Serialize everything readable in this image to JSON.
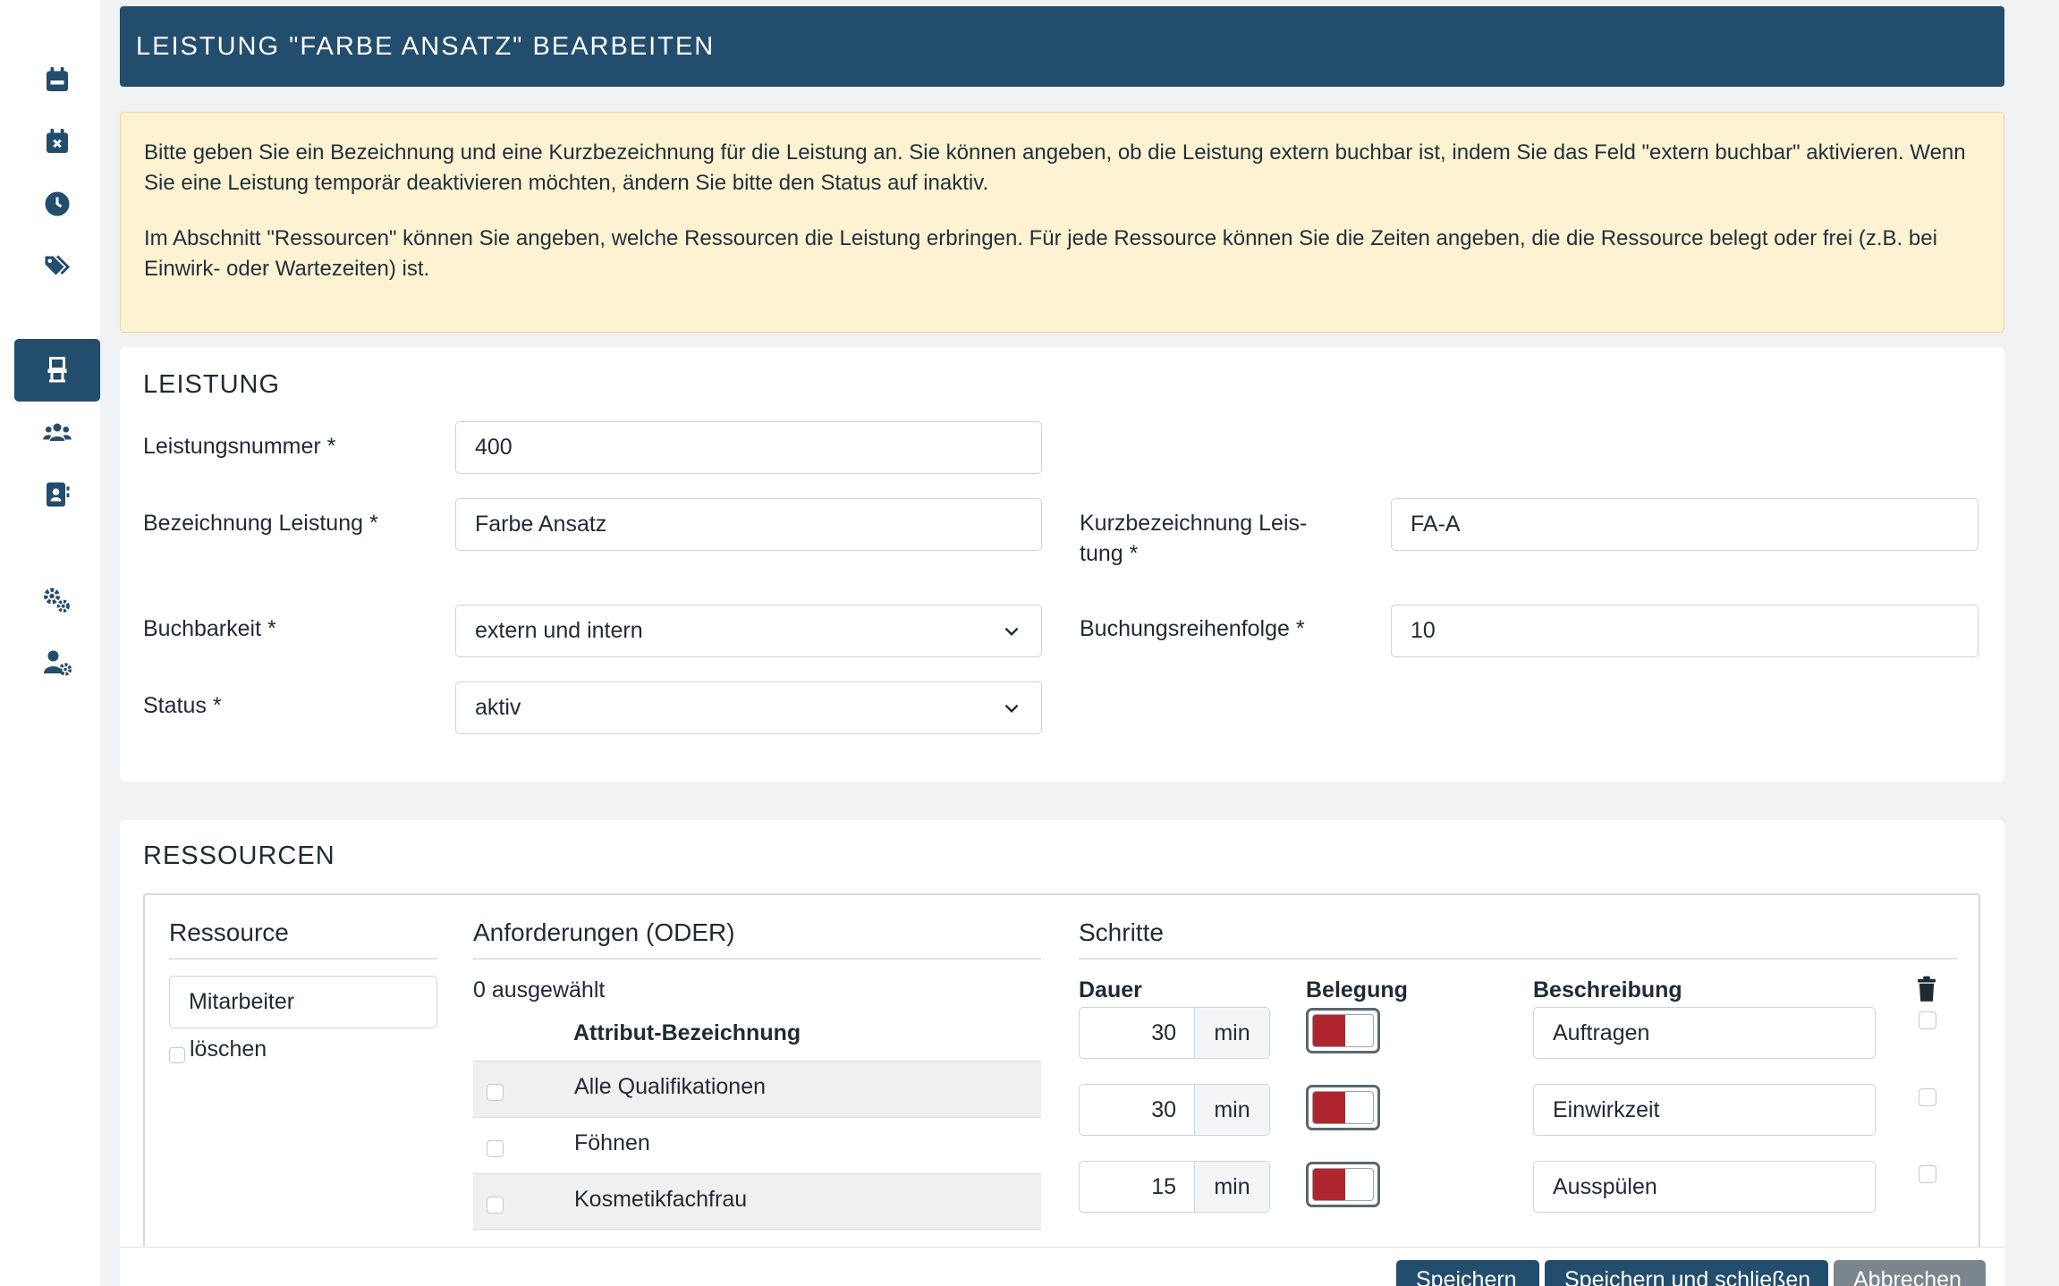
{
  "header": {
    "title": "LEISTUNG \"FARBE ANSATZ\" BEARBEITEN"
  },
  "sidebar": {
    "items": [
      {
        "icon": "calendar-icon",
        "active": false
      },
      {
        "icon": "calendar-x-icon",
        "active": false
      },
      {
        "icon": "clock-icon",
        "active": false
      },
      {
        "icon": "tags-icon",
        "active": false
      },
      {
        "icon": "salon-chair-icon",
        "active": true
      },
      {
        "icon": "users-icon",
        "active": false
      },
      {
        "icon": "address-book-icon",
        "active": false
      },
      {
        "icon": "gears-icon",
        "active": false
      },
      {
        "icon": "user-gear-icon",
        "active": false
      }
    ],
    "active_color": "#234d6c"
  },
  "info": {
    "paragraph1": "Bitte geben Sie ein Bezeichnung und eine Kurzbezeichnung für die Leistung an. Sie können angeben, ob die Leistung extern buchbar ist, indem Sie das Feld \"extern buchbar\" aktivieren. Wenn Sie eine Leistung temporär deaktivieren möchten, ändern Sie bitte den Status auf inaktiv.",
    "paragraph2": "Im Abschnitt \"Ressourcen\" können Sie angeben, welche Ressourcen die Leistung erbringen. Für jede Ressource können Sie die Zeiten angeben, die die Ressource belegt oder frei (z.B. bei Einwirk- oder Wartezeiten) ist."
  },
  "leistung": {
    "title": "LEISTUNG",
    "nummer": {
      "label": "Leistungsnummer *",
      "value": "400"
    },
    "bezeichnung": {
      "label": "Bezeichnung Leistung *",
      "value": "Farbe Ansatz"
    },
    "kurz": {
      "label_line1": "Kurzbezeichnung Leis-",
      "label_line2": "tung *",
      "value": "FA-A"
    },
    "buchbarkeit": {
      "label": "Buchbarkeit *",
      "value": "extern und intern"
    },
    "reihenfolge": {
      "label": "Buchungsreihenfolge *",
      "value": "10"
    },
    "status": {
      "label": "Status *",
      "value": "aktiv"
    }
  },
  "ressourcen": {
    "title": "RESSOURCEN",
    "col_ressource": "Ressource",
    "col_anforderungen": "Anforderungen (ODER)",
    "col_schritte": "Schritte",
    "ressource_value": "Mitarbeiter",
    "loeschen_label": "löschen",
    "selected_count": "0 ausgewählt",
    "attr_header": "Attribut-Bezeichnung",
    "attributes": [
      "Alle Qualifikationen",
      "Föhnen",
      "Kosmetikfachfrau"
    ],
    "schritte_headers": {
      "dauer": "Dauer",
      "belegung": "Belegung",
      "beschreibung": "Beschreibung"
    },
    "steps": [
      {
        "dauer": "30",
        "unit": "min",
        "beschreibung": "Auftragen"
      },
      {
        "dauer": "30",
        "unit": "min",
        "beschreibung": "Einwirkzeit"
      },
      {
        "dauer": "15",
        "unit": "min",
        "beschreibung": "Ausspülen"
      }
    ],
    "toggle_color": "#b0262f"
  },
  "footer": {
    "save": "Speichern",
    "save_close": "Speichern und schließen",
    "cancel": "Abbrechen"
  }
}
